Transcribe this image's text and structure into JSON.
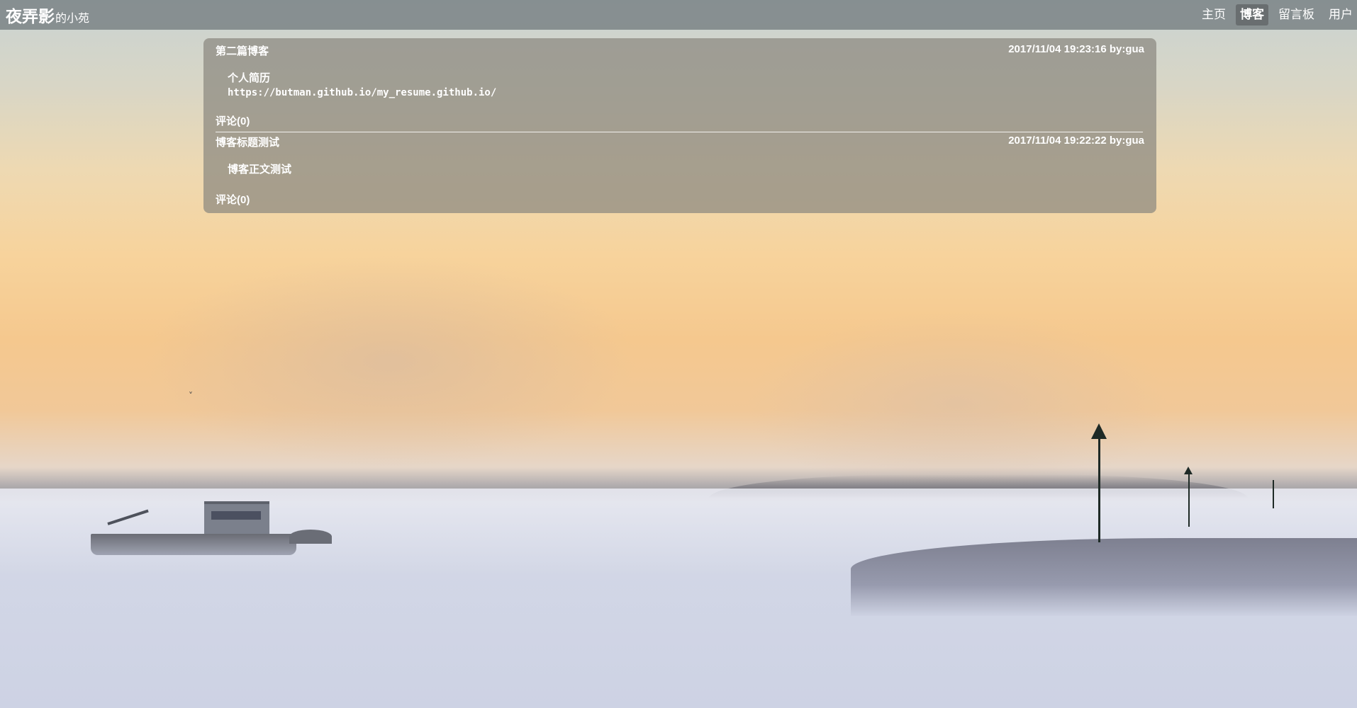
{
  "site": {
    "brand_main": "夜弄影",
    "brand_sub": "的小苑"
  },
  "nav": {
    "items": [
      {
        "label": "主页",
        "active": false
      },
      {
        "label": "博客",
        "active": true
      },
      {
        "label": "留言板",
        "active": false
      },
      {
        "label": "用户",
        "active": false
      }
    ]
  },
  "posts": [
    {
      "title": "第二篇博客",
      "meta": "2017/11/04 19:23:16 by:gua",
      "body_line1": "个人简历",
      "body_line2": "https://butman.github.io/my_resume.github.io/",
      "comments": "评论(0)"
    },
    {
      "title": "博客标题测试",
      "meta": "2017/11/04 19:22:22 by:gua",
      "body_line1": "博客正文测试",
      "comments": "评论(0)"
    }
  ]
}
